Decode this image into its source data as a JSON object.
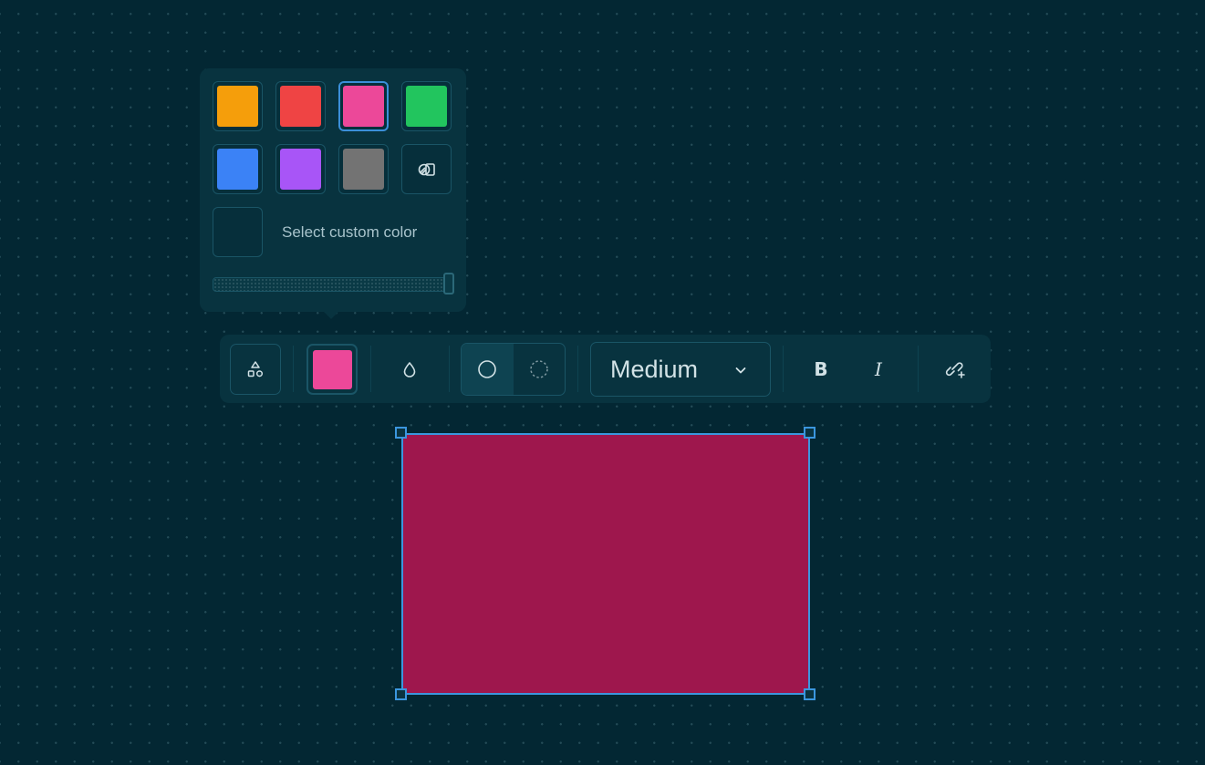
{
  "color_picker": {
    "swatches": [
      {
        "name": "orange",
        "color": "#f59e0b",
        "selected": false
      },
      {
        "name": "red",
        "color": "#ef4444",
        "selected": false
      },
      {
        "name": "pink",
        "color": "#ec4899",
        "selected": true
      },
      {
        "name": "green",
        "color": "#22c55e",
        "selected": false
      },
      {
        "name": "blue",
        "color": "#3b82f6",
        "selected": false
      },
      {
        "name": "purple",
        "color": "#a855f7",
        "selected": false
      },
      {
        "name": "gray",
        "color": "#737373",
        "selected": false
      }
    ],
    "extra_swatch_icon": "palette-swap-icon",
    "custom_color_label": "Select custom color",
    "opacity": 1.0
  },
  "toolbar": {
    "style_icon": "shapes-icon",
    "current_color": "#ec4899",
    "opacity_icon": "droplet-icon",
    "fill_options": [
      {
        "icon": "circle-solid-outline-icon",
        "active": true
      },
      {
        "icon": "circle-dashed-outline-icon",
        "active": false
      }
    ],
    "size_value": "Medium",
    "size_chevron_icon": "chevron-down-icon",
    "bold_label": "B",
    "italic_label": "I",
    "link_icon": "link-add-icon"
  },
  "canvas": {
    "selected_shape": {
      "type": "rectangle",
      "fill": "#9e174d",
      "stroke": "#3b96de"
    }
  }
}
